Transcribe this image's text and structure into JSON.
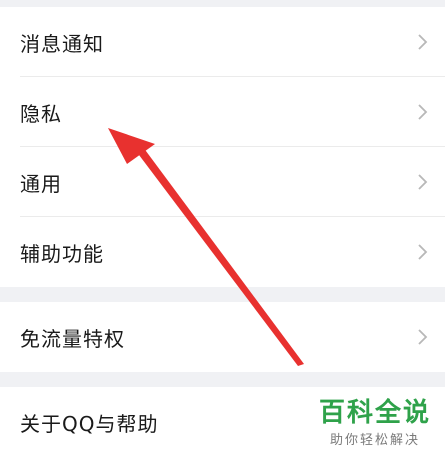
{
  "settings_group_1": {
    "items": [
      {
        "label": "消息通知"
      },
      {
        "label": "隐私"
      },
      {
        "label": "通用"
      },
      {
        "label": "辅助功能"
      }
    ]
  },
  "settings_group_2": {
    "items": [
      {
        "label": "免流量特权"
      }
    ]
  },
  "settings_group_3": {
    "items": [
      {
        "label": "关于QQ与帮助"
      }
    ]
  },
  "watermark": {
    "title": "百科全说",
    "subtitle": "助你轻松解决"
  },
  "colors": {
    "background": "#f0f1f4",
    "arrow": "#e8312f",
    "watermark_green": "#2fa24a"
  },
  "icons": {
    "row_chevron": "chevron-right-icon",
    "annotation": "red-arrow-annotation"
  }
}
